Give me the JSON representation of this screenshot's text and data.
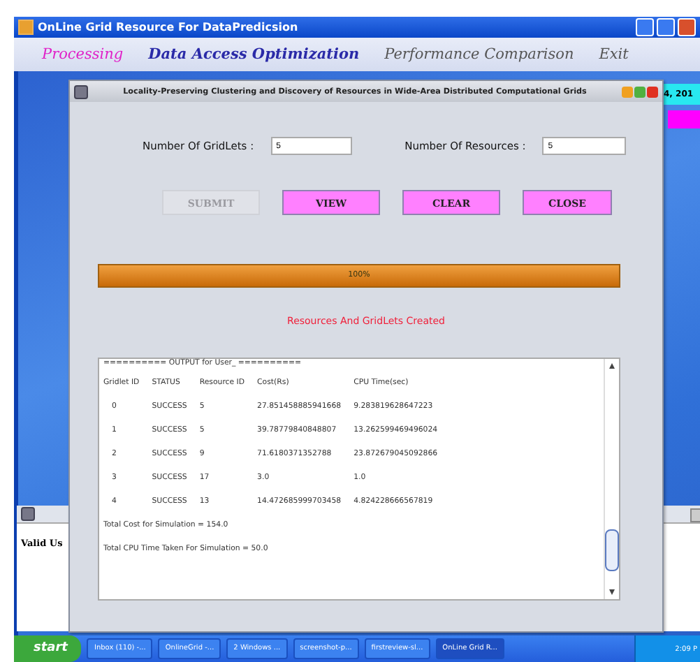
{
  "window": {
    "title": "OnLine Grid Resource For DataPredicsion"
  },
  "menu": [
    {
      "label": "Processing",
      "selected": true
    },
    {
      "label": "Data Access Optimization",
      "selected": false
    },
    {
      "label": "Performance Comparison",
      "selected": false
    },
    {
      "label": "Exit",
      "selected": false
    }
  ],
  "side_labels": [
    "4, 201"
  ],
  "background_window": {
    "text": "Valid Us"
  },
  "dialog": {
    "title": "Locality-Preserving Clustering and Discovery of Resources in Wide-Area Distributed Computational Grids",
    "fields": [
      {
        "label": "Number Of GridLets :",
        "value": "5"
      },
      {
        "label": "Number Of Resources :",
        "value": "5"
      }
    ],
    "buttons": [
      {
        "label": "SUBMIT",
        "disabled": true
      },
      {
        "label": "VIEW",
        "disabled": false
      },
      {
        "label": "CLEAR",
        "disabled": false
      },
      {
        "label": "CLOSE",
        "disabled": false
      }
    ],
    "progress": {
      "level": 1,
      "reading": "100%"
    },
    "status": "Resources And GridLets Created",
    "output": {
      "header": "========== OUTPUT for User_ ==========",
      "columns": [
        "Gridlet ID",
        "STATUS",
        "Resource ID",
        "Cost(Rs)",
        "CPU Time(sec)"
      ],
      "rows": [
        [
          "0",
          "SUCCESS",
          "5",
          "27.851458885941668",
          "9.283819628647223"
        ],
        [
          "1",
          "SUCCESS",
          "5",
          "39.78779840848807",
          "13.262599469496024"
        ],
        [
          "2",
          "SUCCESS",
          "9",
          "71.6180371352788",
          "23.872679045092866"
        ],
        [
          "3",
          "SUCCESS",
          "17",
          "3.0",
          "1.0"
        ],
        [
          "4",
          "SUCCESS",
          "13",
          "14.472685999703458",
          "4.824228666567819"
        ]
      ],
      "totals": [
        "Total Cost for Simulation = 154.0",
        "Total CPU Time Taken For Simulation = 50.0"
      ]
    }
  },
  "taskbar": {
    "start": "start",
    "items": [
      "Inbox (110) -...",
      "OnlineGrid -...",
      "2 Windows ...",
      "screenshot-p...",
      "firstreview-sl...",
      "OnLine Grid R..."
    ],
    "clock": "2:09 P"
  }
}
